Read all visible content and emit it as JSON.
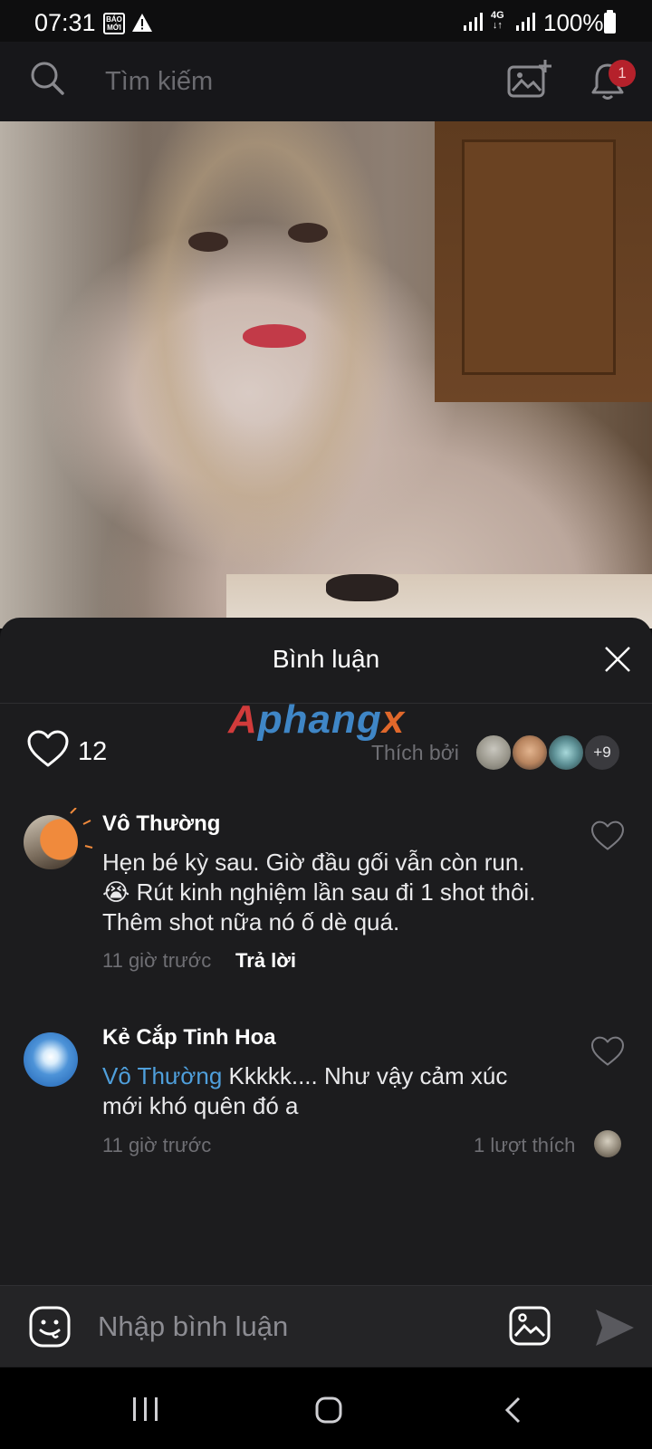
{
  "status_bar": {
    "time": "07:31",
    "app_badge": "BÁO MỚI",
    "network": "4G",
    "battery": "100%"
  },
  "header": {
    "search_placeholder": "Tìm kiếm",
    "notification_count": "1"
  },
  "comments_sheet": {
    "title": "Bình luận",
    "like_count": "12",
    "liked_by_label": "Thích bởi",
    "more_likers": "+9",
    "watermark": {
      "part1": "A",
      "part2": "phang",
      "part3": "x"
    }
  },
  "comments": [
    {
      "author": "Vô Thường",
      "text_line1": "Hẹn bé kỳ sau. Giờ đầu gối vẫn còn run.",
      "text_line2": "😭 Rút kinh nghiệm lần sau đi 1 shot thôi.",
      "text_line3": "Thêm shot nữa nó ố dè quá.",
      "time": "11 giờ trước",
      "reply_label": "Trả lời"
    },
    {
      "author": "Kẻ Cắp Tinh Hoa",
      "mention": "Vô Thường",
      "text_line1": " Kkkkk.... Như vậy cảm xúc",
      "text_line2": "mới khó quên đó a",
      "time": "11 giờ trước",
      "likes": "1 lượt thích"
    }
  ],
  "comment_input": {
    "placeholder": "Nhập bình luận"
  },
  "colors": {
    "sheet_bg": "#1c1c1e",
    "mention": "#4f9fdb",
    "badge": "#b5212b"
  },
  "icons": [
    "search-icon",
    "add-photo-icon",
    "bell-icon",
    "heart-icon",
    "close-icon",
    "emoji-icon",
    "image-icon",
    "send-icon",
    "recent-apps-icon",
    "home-icon",
    "back-icon"
  ]
}
